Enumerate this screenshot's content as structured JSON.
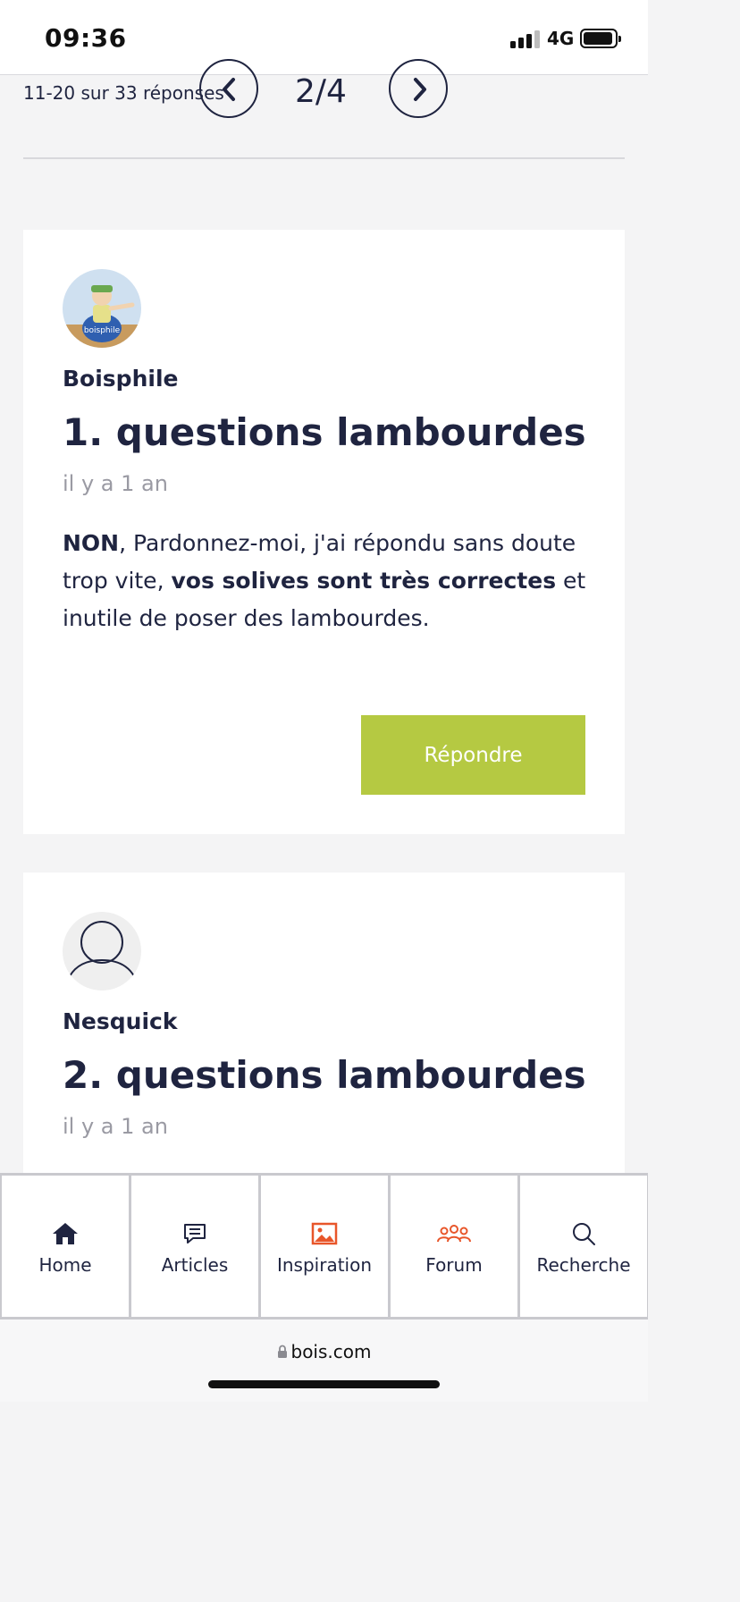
{
  "status_bar": {
    "time": "09:36",
    "network": "4G"
  },
  "pagination": {
    "count_text": "11-20 sur 33 réponses",
    "page_text": "2/4"
  },
  "posts": [
    {
      "author": "Boisphile",
      "title": "1. questions lambourdes",
      "time": "il y a 1 an",
      "body": {
        "p1_bold": "NON",
        "p2": ", Pardonnez-moi, j'ai répondu sans doute trop vite, ",
        "p3_bold": "vos solives sont très correctes",
        "p4": " et inutile de poser des lambourdes."
      },
      "reply_label": "Répondre"
    },
    {
      "author": "Nesquick",
      "title": "2. questions lambourdes",
      "time": "il y a 1 an"
    }
  ],
  "tabbar": {
    "items": [
      {
        "label": "Home",
        "icon": "home-icon"
      },
      {
        "label": "Articles",
        "icon": "articles-icon"
      },
      {
        "label": "Inspiration",
        "icon": "image-icon"
      },
      {
        "label": "Forum",
        "icon": "forum-icon"
      },
      {
        "label": "Recherche",
        "icon": "search-icon"
      }
    ]
  },
  "browser": {
    "url": "bois.com"
  },
  "colors": {
    "reply_button": "#b5c942",
    "accent_orange": "#e8562a",
    "text_dark": "#1f2440"
  }
}
